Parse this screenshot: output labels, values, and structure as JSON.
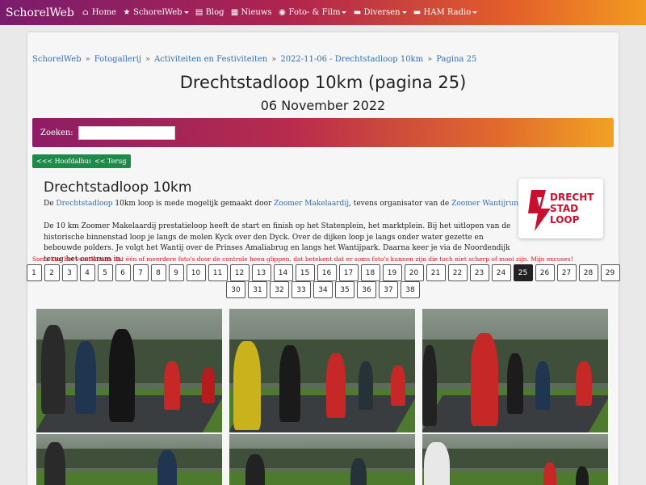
{
  "nav": {
    "brand": "SchorelWeb",
    "items": [
      {
        "label": "Home",
        "icon": "home-icon",
        "glyph": "⌂",
        "dropdown": false
      },
      {
        "label": "SchorelWeb",
        "icon": "star-icon",
        "glyph": "★",
        "dropdown": true
      },
      {
        "label": "Blog",
        "icon": "blog-icon",
        "glyph": "▤",
        "dropdown": false
      },
      {
        "label": "Nieuws",
        "icon": "news-icon",
        "glyph": "▦",
        "dropdown": false
      },
      {
        "label": "Foto- & Film",
        "icon": "camera-icon",
        "glyph": "◉",
        "dropdown": true
      },
      {
        "label": "Diversen",
        "icon": "folder-icon",
        "glyph": "▬",
        "dropdown": true
      },
      {
        "label": "HAM Radio",
        "icon": "folder-icon",
        "glyph": "▬",
        "dropdown": true
      }
    ]
  },
  "breadcrumb": [
    "SchorelWeb",
    "Fotogallerij",
    "Activiteiten en Festiviteiten",
    "2022-11-06 - Drechtstadloop 10km",
    "Pagina 25"
  ],
  "page": {
    "title": "Drechtstadloop 10km (pagina 25)",
    "date": "06 November 2022"
  },
  "search": {
    "label": "Zoeken:",
    "value": ""
  },
  "buttons": {
    "hoofdalbum": "<<< Hoofdalbum",
    "terug": "<< Terug"
  },
  "album": {
    "heading": "Drechtstadloop 10km",
    "intro_1": "De ",
    "intro_link_1": "Drechtstadloop",
    "intro_2": " 10km loop is mede mogelijk gemaakt door ",
    "intro_link_2": "Zoomer Makelaardij",
    "intro_3": ", tevens organisator van de ",
    "intro_link_3": "Zoomer Wantijrun",
    "intro_4": ".",
    "paragraph": "De 10 km Zoomer Makelaardij prestatieloop heeft de start en finish op het Statenplein, het marktplein. Bij het uitlopen van de historische binnenstad loop je langs de molen Kyck over den Dyck. Over de dijken loop je langs onder water gezette en bebouwde polders. Je volgt het Wantij over de Prinses Amaliabrug en langs het Wantijpark. Daarna keer je via de Noordendijk terug het centrum in.",
    "logo_text": [
      "DRECHT",
      "STAD",
      "LOOP"
    ]
  },
  "warning": "Soms kan het voor komen dat één of meerdere foto's door de controle heen glippen, dat betekent dat er soms foto's kunnen zijn die toch niet scherp of mooi zijn. Mijn excuses!",
  "pagination": {
    "row1": [
      "1",
      "2",
      "3",
      "4",
      "5",
      "6",
      "7",
      "8",
      "9",
      "10",
      "11",
      "12",
      "13",
      "14",
      "15",
      "16",
      "17",
      "18",
      "19",
      "20",
      "21",
      "22",
      "23",
      "24",
      "25",
      "26",
      "27",
      "28",
      "29"
    ],
    "row2": [
      "30",
      "31",
      "32",
      "33",
      "34",
      "35",
      "36",
      "37",
      "38"
    ],
    "current": "25"
  },
  "colors": {
    "accent_link": "#2c6fbd",
    "button_green": "#1e8a4a",
    "warning_red": "#dd1111"
  }
}
